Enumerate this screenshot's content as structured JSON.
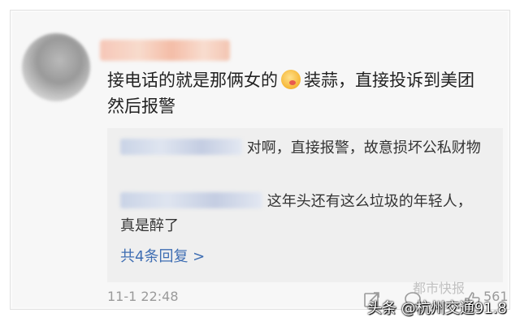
{
  "comment": {
    "text_before_emoji": "接电话的就是那俩女的",
    "emoji_icon": "face-emoji-icon",
    "text_after_emoji": "装蒜，直接投诉到美团然后报警"
  },
  "replies": [
    {
      "text": "对啊，直接报警，故意损坏公私财物"
    },
    {
      "text": "这年头还有这么垃圾的年轻人，真是醉了"
    }
  ],
  "more_replies_label": "共4条回复 >",
  "timestamp": "11-1 22:48",
  "like_count": "561",
  "watermarks": {
    "overlay": "都市快报",
    "source": "头条 @杭州交通91.8"
  },
  "colors": {
    "link": "#3f6eb3",
    "meta": "#9a9a9a",
    "reply_bg": "#efefef"
  }
}
